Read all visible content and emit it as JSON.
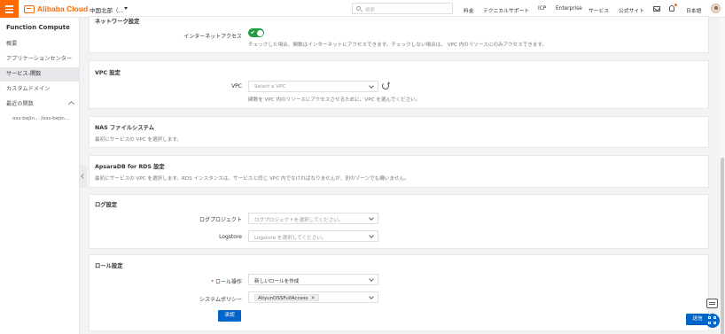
{
  "brand": {
    "name": "Alibaba Cloud",
    "accent": "#ff6a00",
    "primary": "#0064c8"
  },
  "header": {
    "region": "中国北部（...",
    "search_placeholder": "検索",
    "nav": [
      "料金",
      "テクニカルサポート",
      "ICP",
      "Enterprise",
      "サービス",
      "公式サイト"
    ],
    "language": "日本語"
  },
  "sidebar": {
    "title": "Function Compute",
    "items": [
      "概要",
      "アプリケーションセンター",
      "サービス-関数",
      "カスタムドメイン"
    ],
    "active": "サービス-関数",
    "recent_label": "最近の関数",
    "recent_items": [
      "oss-bejin... /oss-bejin..."
    ]
  },
  "network": {
    "title": "ネットワーク設定",
    "internet_label": "インターネットアクセス",
    "internet_enabled": true,
    "internet_desc": "チェックした場合、関数はインターネットにアクセスできます。チェックしない場合は、 VPC 内のリソースにのみアクセスできます。"
  },
  "vpc": {
    "title": "VPC 設定",
    "label": "VPC",
    "placeholder": "Select a VPC",
    "desc": "関数を VPC 内のリソースにアクセスさせるために、VPC を選んでください。"
  },
  "nas": {
    "title": "NAS ファイルシステム",
    "desc": "最初にサービスの VPC を選択します。"
  },
  "rds": {
    "title": "ApsaraDB for RDS 設定",
    "desc": "最初にサービスの VPC を選択します。RDS インスタンスは、サービスと同じ VPC 内でなければなりませんが、別のゾーンでも構いません。"
  },
  "log": {
    "title": "ログ設定",
    "project_label": "ログプロジェクト",
    "project_placeholder": "ログプロジェクトを選択してください。",
    "logstore_label": "Logstore",
    "logstore_placeholder": "Logstore を選択してください。"
  },
  "role": {
    "title": "ロール設定",
    "operation_label": "ロール操作",
    "required_mark": "*",
    "operation_value": "新しいロールを作成",
    "policy_label": "システムポリシー",
    "policy_tag": "AliyunOSSFullAccess",
    "approve_button": "承認"
  },
  "footer": {
    "submit_button": "送信"
  }
}
